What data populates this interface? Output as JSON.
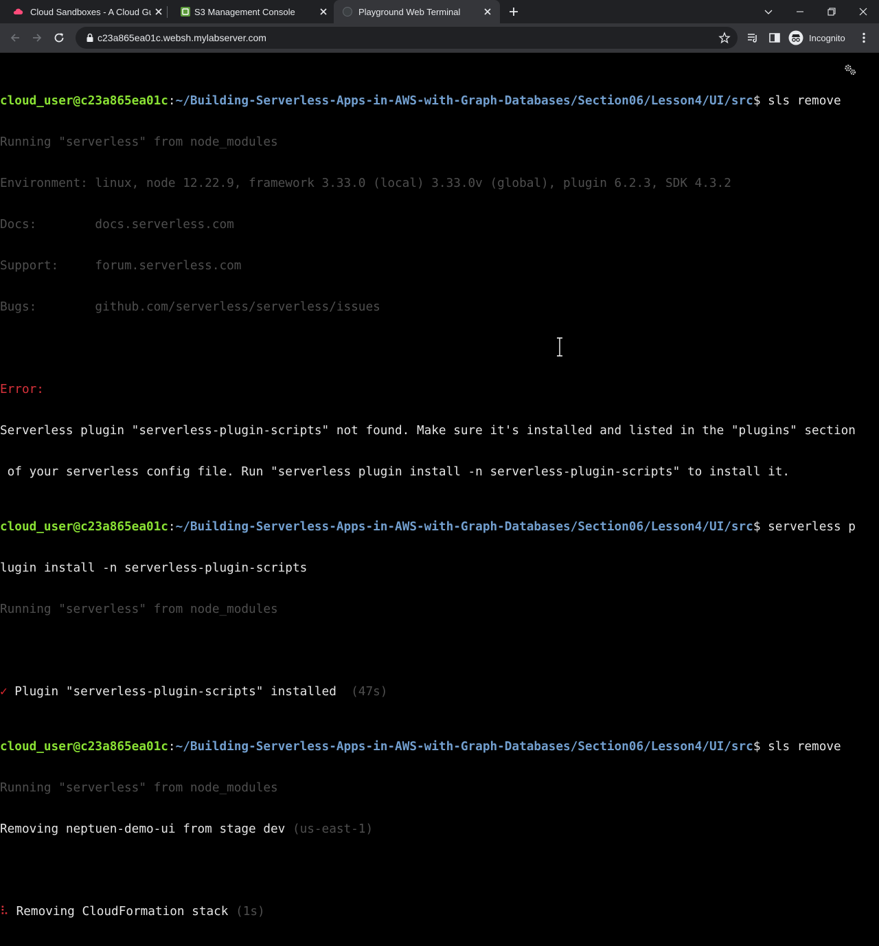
{
  "browser": {
    "tabs": [
      {
        "title": "Cloud Sandboxes - A Cloud Guru",
        "active": false,
        "favicon": "cloud-guru-icon"
      },
      {
        "title": "S3 Management Console",
        "active": false,
        "favicon": "aws-s3-icon"
      },
      {
        "title": "Playground Web Terminal",
        "active": true,
        "favicon": "globe-icon"
      }
    ],
    "url": "c23a865ea01c.websh.mylabserver.com",
    "profile_label": "Incognito",
    "colors": {
      "tabstrip": "#202124",
      "toolbar": "#35363a",
      "omnibox": "#202124"
    }
  },
  "terminal": {
    "prompt_user": "cloud_user@c23a865ea01c",
    "prompt_sep": ":",
    "prompt_path": "~/Building-Serverless-Apps-in-AWS-with-Graph-Databases/Section06/Lesson4/UI/src",
    "prompt_end": "$ ",
    "cmd1": "sls remove",
    "running": "Running \"serverless\" from node_modules",
    "env": "Environment: linux, node 12.22.9, framework 3.33.0 (local) 3.33.0v (global), plugin 6.2.3, SDK 4.3.2",
    "docs": "Docs:        docs.serverless.com",
    "support": "Support:     forum.serverless.com",
    "bugs": "Bugs:        github.com/serverless/serverless/issues",
    "error_label": "Error:",
    "error_l1": "Serverless plugin \"serverless-plugin-scripts\" not found. Make sure it's installed and listed in the \"plugins\" section",
    "error_l2": " of your serverless config file. Run \"serverless plugin install -n serverless-plugin-scripts\" to install it.",
    "cmd2_part1": "serverless p",
    "cmd2_part2": "lugin install -n serverless-plugin-scripts",
    "check_mark": "✓",
    "plugin_installed": " Plugin \"serverless-plugin-scripts\" installed",
    "plugin_time": "  (47s)",
    "cmd3": "sls remove",
    "removing_service": "Removing neptuen-demo-ui from stage dev",
    "region": " (us-east-1)",
    "spinner": "⠧",
    "removing_stack": " Removing CloudFormation stack",
    "stack_time": " (1s)",
    "colors": {
      "user": "#8ae234",
      "path": "#729fcf",
      "error": "#d9323b",
      "dim": "#4f4f4f",
      "text": "#e6e6e6",
      "background": "#000000"
    }
  }
}
